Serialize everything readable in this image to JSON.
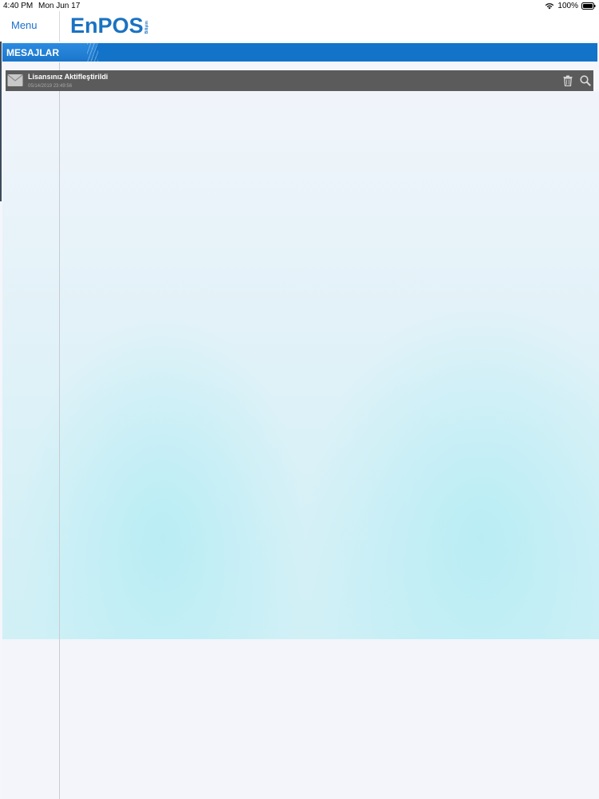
{
  "status_bar": {
    "time": "4:40 PM",
    "date": "Mon Jun 17",
    "battery": "100%"
  },
  "nav": {
    "menu_label": "Menu",
    "logo_text": "EnPOS",
    "logo_sub": "Bilişim"
  },
  "section": {
    "title": "MESAJLAR"
  },
  "messages": [
    {
      "title": "Lisansınız Aktifleştirildi",
      "date": "05/14/2019 23:49:56"
    }
  ],
  "colors": {
    "brand_blue": "#1373c8",
    "row_bg": "#5b5b5b"
  },
  "icons": {
    "mail": "mail-icon",
    "trash": "trash-icon",
    "search": "search-icon",
    "wifi": "wifi-icon",
    "battery": "battery-icon"
  }
}
